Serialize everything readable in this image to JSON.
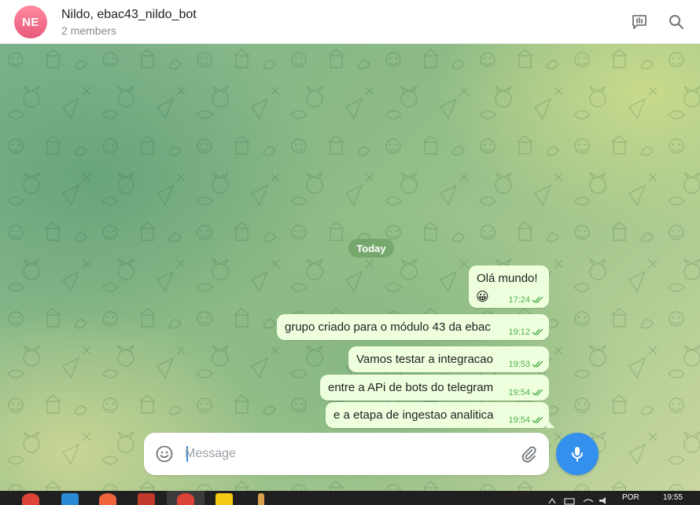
{
  "header": {
    "avatar_initials": "NE",
    "title": "Nildo, ebac43_nildo_bot",
    "subtitle": "2 members",
    "icons": [
      "live-stream-icon",
      "search-icon"
    ]
  },
  "chat": {
    "date_label": "Today",
    "messages": [
      {
        "text": "Olá mundo!",
        "emoji": "😀",
        "time": "17:24",
        "status": "read"
      },
      {
        "text": "grupo criado para o módulo 43 da ebac",
        "time": "19:12",
        "status": "read"
      },
      {
        "text": "Vamos testar a integracao",
        "time": "19:53",
        "status": "read"
      },
      {
        "text": "entre a APi de bots do telegram",
        "time": "19:54",
        "status": "read"
      },
      {
        "text": "e a etapa de ingestao analitica",
        "time": "19:54",
        "status": "read"
      }
    ]
  },
  "composer": {
    "placeholder": "Message",
    "value": ""
  },
  "taskbar": {
    "language": "POR",
    "clock": "19:55"
  },
  "colors": {
    "accent": "#3390ec",
    "bubble_out": "#eeffde",
    "check": "#4fae4e",
    "avatar": "#e85a7a"
  }
}
